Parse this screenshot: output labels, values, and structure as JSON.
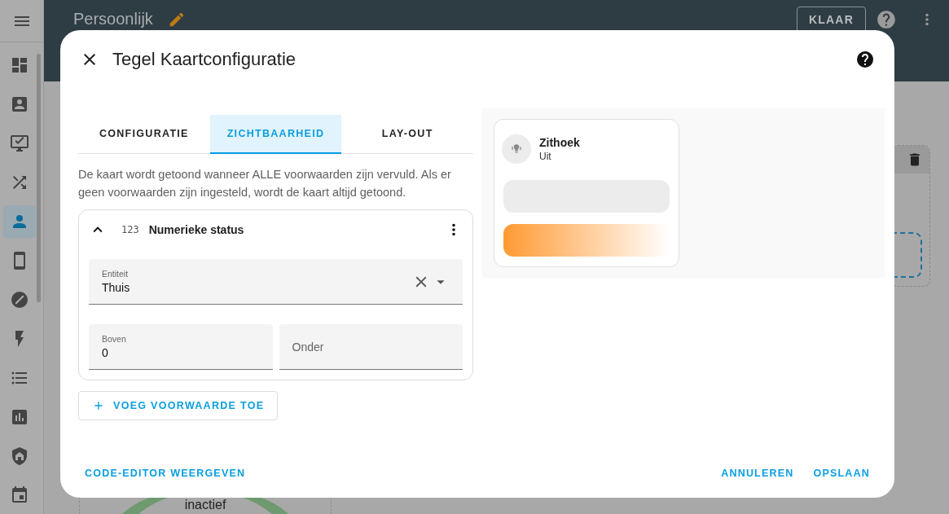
{
  "sidebar": {
    "items": [
      {
        "selected": false
      },
      {
        "selected": false
      },
      {
        "selected": false
      },
      {
        "selected": false
      },
      {
        "selected": true
      },
      {
        "selected": false
      },
      {
        "selected": false
      },
      {
        "selected": false
      },
      {
        "selected": false
      },
      {
        "selected": false
      },
      {
        "selected": false
      },
      {
        "selected": false
      }
    ]
  },
  "header": {
    "title": "Persoonlijk",
    "done_button": "KLAAR"
  },
  "background_card": {
    "label": "inactief"
  },
  "dialog": {
    "title": "Tegel Kaartconfiguratie",
    "tabs": [
      {
        "label": "CONFIGURATIE",
        "selected": false
      },
      {
        "label": "ZICHTBAARHEID",
        "selected": true
      },
      {
        "label": "LAY-OUT",
        "selected": false
      }
    ],
    "description": "De kaart wordt getoond wanneer ALLE voorwaarden zijn vervuld. Als er geen voorwaarden zijn ingesteld, wordt de kaart altijd getoond.",
    "condition": {
      "icon_text": "123",
      "title": "Numerieke status",
      "expanded": true,
      "entity_field": {
        "label": "Entiteit",
        "value": "Thuis"
      },
      "fields": [
        {
          "label": "Boven",
          "value": "0"
        },
        {
          "placeholder": "Onder"
        }
      ]
    },
    "add_button": "VOEG VOORWAARDE TOE",
    "preview": {
      "name": "Zithoek",
      "state": "Uit"
    },
    "code_editor_button": "CODE-EDITOR WEERGEVEN",
    "actions": [
      "ANNULEREN",
      "OPSLAAN"
    ]
  }
}
